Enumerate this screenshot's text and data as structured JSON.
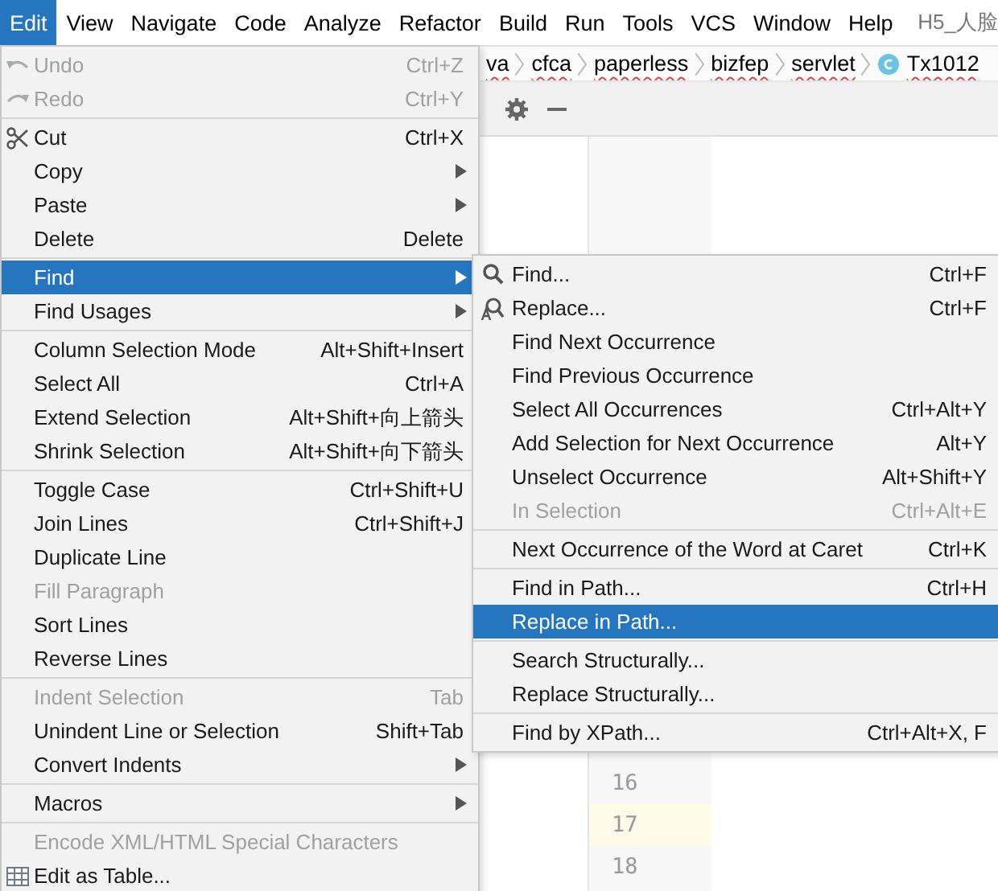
{
  "menubar": [
    {
      "label": "Edit",
      "selected": true
    },
    {
      "label": "View",
      "selected": false
    },
    {
      "label": "Navigate",
      "selected": false
    },
    {
      "label": "Code",
      "selected": false
    },
    {
      "label": "Analyze",
      "selected": false
    },
    {
      "label": "Refactor",
      "selected": false
    },
    {
      "label": "Build",
      "selected": false
    },
    {
      "label": "Run",
      "selected": false
    },
    {
      "label": "Tools",
      "selected": false
    },
    {
      "label": "VCS",
      "selected": false
    },
    {
      "label": "Window",
      "selected": false
    },
    {
      "label": "Help",
      "selected": false
    }
  ],
  "window_title": "H5_人脸",
  "breadcrumbs": [
    "va",
    "cfca",
    "paperless",
    "bizfep",
    "servlet",
    "Tx1012"
  ],
  "line_numbers": [
    "16",
    "17",
    "18"
  ],
  "edit_menu": [
    [
      {
        "label": "Undo",
        "shortcut": "Ctrl+Z",
        "kind": "undo",
        "disabled": true,
        "submenu": false,
        "selected": false
      },
      {
        "label": "Redo",
        "shortcut": "Ctrl+Y",
        "kind": "redo",
        "disabled": true,
        "submenu": false,
        "selected": false
      }
    ],
    [
      {
        "label": "Cut",
        "shortcut": "Ctrl+X",
        "kind": "cut",
        "disabled": false,
        "submenu": false,
        "selected": false
      },
      {
        "label": "Copy",
        "disabled": false,
        "submenu": true,
        "selected": false
      },
      {
        "label": "Paste",
        "disabled": false,
        "submenu": true,
        "selected": false
      },
      {
        "label": "Delete",
        "shortcut": "Delete",
        "disabled": false,
        "submenu": false,
        "selected": false
      }
    ],
    [
      {
        "label": "Find",
        "disabled": false,
        "submenu": true,
        "selected": true
      },
      {
        "label": "Find Usages",
        "disabled": false,
        "submenu": true,
        "selected": false
      }
    ],
    [
      {
        "label": "Column Selection Mode",
        "shortcut": "Alt+Shift+Insert",
        "disabled": false,
        "submenu": false,
        "selected": false
      },
      {
        "label": "Select All",
        "shortcut": "Ctrl+A",
        "disabled": false,
        "submenu": false,
        "selected": false
      },
      {
        "label": "Extend Selection",
        "shortcut": "Alt+Shift+向上箭头",
        "disabled": false,
        "submenu": false,
        "selected": false
      },
      {
        "label": "Shrink Selection",
        "shortcut": "Alt+Shift+向下箭头",
        "disabled": false,
        "submenu": false,
        "selected": false
      }
    ],
    [
      {
        "label": "Toggle Case",
        "shortcut": "Ctrl+Shift+U",
        "disabled": false,
        "submenu": false,
        "selected": false
      },
      {
        "label": "Join Lines",
        "shortcut": "Ctrl+Shift+J",
        "disabled": false,
        "submenu": false,
        "selected": false
      },
      {
        "label": "Duplicate Line",
        "disabled": false,
        "submenu": false,
        "selected": false
      },
      {
        "label": "Fill Paragraph",
        "disabled": true,
        "submenu": false,
        "selected": false
      },
      {
        "label": "Sort Lines",
        "disabled": false,
        "submenu": false,
        "selected": false
      },
      {
        "label": "Reverse Lines",
        "disabled": false,
        "submenu": false,
        "selected": false
      }
    ],
    [
      {
        "label": "Indent Selection",
        "shortcut": "Tab",
        "disabled": true,
        "submenu": false,
        "selected": false
      },
      {
        "label": "Unindent Line or Selection",
        "shortcut": "Shift+Tab",
        "disabled": false,
        "submenu": false,
        "selected": false
      },
      {
        "label": "Convert Indents",
        "disabled": false,
        "submenu": true,
        "selected": false
      }
    ],
    [
      {
        "label": "Macros",
        "disabled": false,
        "submenu": true,
        "selected": false
      }
    ],
    [
      {
        "label": "Encode XML/HTML Special Characters",
        "disabled": true,
        "submenu": false,
        "selected": false
      },
      {
        "label": "Edit as Table...",
        "kind": "table",
        "disabled": false,
        "submenu": false,
        "selected": false
      }
    ]
  ],
  "find_submenu": [
    [
      {
        "label": "Find...",
        "shortcut": "Ctrl+F",
        "kind": "search",
        "disabled": false,
        "selected": false
      },
      {
        "label": "Replace...",
        "shortcut": "Ctrl+F",
        "kind": "replace",
        "disabled": false,
        "selected": false
      },
      {
        "label": "Find Next Occurrence",
        "disabled": false,
        "selected": false
      },
      {
        "label": "Find Previous Occurrence",
        "disabled": false,
        "selected": false
      },
      {
        "label": "Select All Occurrences",
        "shortcut": "Ctrl+Alt+Y",
        "disabled": false,
        "selected": false
      },
      {
        "label": "Add Selection for Next Occurrence",
        "shortcut": "Alt+Y",
        "disabled": false,
        "selected": false
      },
      {
        "label": "Unselect Occurrence",
        "shortcut": "Alt+Shift+Y",
        "disabled": false,
        "selected": false
      },
      {
        "label": "In Selection",
        "shortcut": "Ctrl+Alt+E",
        "disabled": true,
        "selected": false
      }
    ],
    [
      {
        "label": "Next Occurrence of the Word at Caret",
        "shortcut": "Ctrl+K",
        "disabled": false,
        "selected": false
      }
    ],
    [
      {
        "label": "Find in Path...",
        "shortcut": "Ctrl+H",
        "disabled": false,
        "selected": false
      },
      {
        "label": "Replace in Path...",
        "disabled": false,
        "selected": true
      }
    ],
    [
      {
        "label": "Search Structurally...",
        "disabled": false,
        "selected": false
      },
      {
        "label": "Replace Structurally...",
        "disabled": false,
        "selected": false
      }
    ],
    [
      {
        "label": "Find by XPath...",
        "shortcut": "Ctrl+Alt+X, F",
        "disabled": false,
        "selected": false
      }
    ]
  ]
}
